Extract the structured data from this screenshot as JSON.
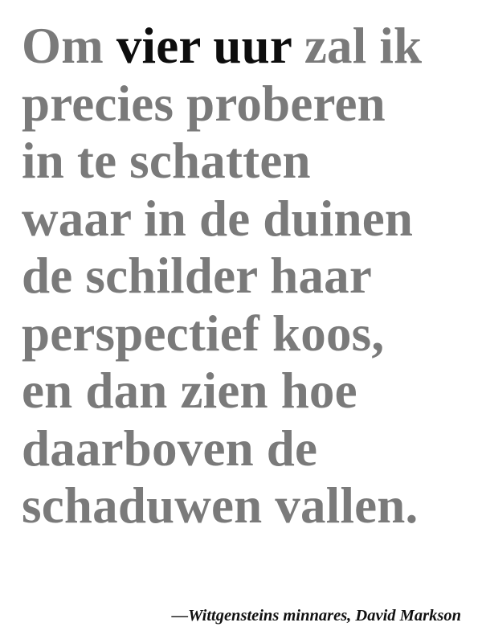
{
  "quote": {
    "line1_pre": "Om ",
    "line1_emph": "vier uur",
    "line1_post": " zal ik",
    "lines": [
      "precies proberen",
      "in te schatten",
      "waar in de duinen",
      "de schilder haar",
      "perspectief koos,",
      "en dan zien hoe",
      "daarboven de",
      "schaduwen vallen."
    ]
  },
  "attribution": "—Wittgensteins minnares, David Markson",
  "colors": {
    "text": "#7a7a7a",
    "emphasis": "#0d0d0d",
    "attribution": "#111111",
    "background": "#ffffff"
  }
}
